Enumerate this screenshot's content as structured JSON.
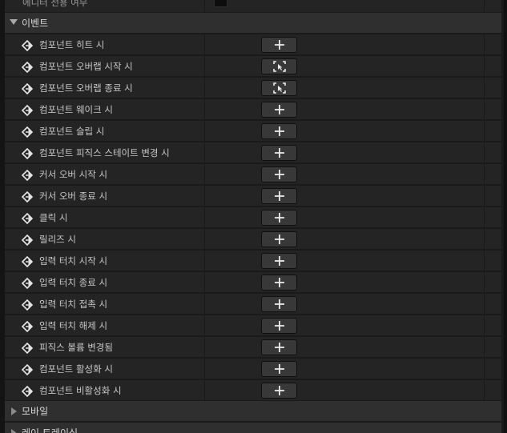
{
  "top_property": {
    "label": "에디터 전용 여부"
  },
  "categories": {
    "events": "이벤트",
    "mobile": "모바일",
    "ray_tracing": "레이 트레이싱"
  },
  "events": [
    {
      "label": "컴포넌트 히트 시",
      "button_icon": "plus-icon"
    },
    {
      "label": "컴포넌트 오버랩 시작 시",
      "button_icon": "focus-select-icon"
    },
    {
      "label": "컴포넌트 오버랩 종료 시",
      "button_icon": "focus-select-icon"
    },
    {
      "label": "컴포넌트 웨이크 시",
      "button_icon": "plus-icon"
    },
    {
      "label": "컴포넌트 슬립 시",
      "button_icon": "plus-icon"
    },
    {
      "label": "컴포넌트 피직스 스테이트 변경 시",
      "button_icon": "plus-icon"
    },
    {
      "label": "커서 오버 시작 시",
      "button_icon": "plus-icon"
    },
    {
      "label": "커서 오버 종료 시",
      "button_icon": "plus-icon"
    },
    {
      "label": "클릭 시",
      "button_icon": "plus-icon"
    },
    {
      "label": "릴리즈 시",
      "button_icon": "plus-icon"
    },
    {
      "label": "입력 터치 시작 시",
      "button_icon": "plus-icon"
    },
    {
      "label": "입력 터치 종료 시",
      "button_icon": "plus-icon"
    },
    {
      "label": "입력 터치 접촉 시",
      "button_icon": "plus-icon"
    },
    {
      "label": "입력 터치 해제 시",
      "button_icon": "plus-icon"
    },
    {
      "label": "피직스 볼륨 변경됨",
      "button_icon": "plus-icon"
    },
    {
      "label": "컴포넌트 활성화 시",
      "button_icon": "plus-icon"
    },
    {
      "label": "컴포넌트 비활성화 시",
      "button_icon": "plus-icon"
    }
  ],
  "colors": {
    "row_bg": "#242424",
    "category_bg": "#2f2f2f",
    "button_bg": "#383838",
    "text": "#c8c8c8"
  }
}
